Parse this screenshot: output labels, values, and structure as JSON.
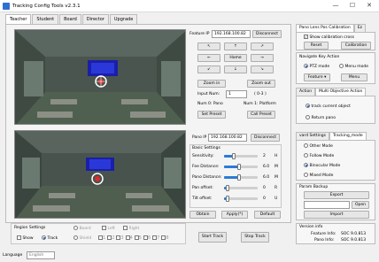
{
  "window": {
    "title": "Tracking Config Tools v2.3.1",
    "min": "—",
    "max": "☐",
    "close": "✕"
  },
  "tabs": [
    "Teacher",
    "Student",
    "Board",
    "Director",
    "Upgrade"
  ],
  "top": {
    "feature_ip_label": "Feature IP",
    "feature_ip": "192.168.100.82",
    "disconnect": "Disconnect",
    "dir_up_left": "↖",
    "dir_up": "↑",
    "dir_up_right": "↗",
    "dir_left": "←",
    "home": "Home",
    "dir_right": "→",
    "dir_down_left": "↙",
    "dir_down": "↓",
    "dir_down_right": "↘",
    "zoom_in": "Zoom in",
    "zoom_out": "Zoom out",
    "input_num_label": "Input Num:",
    "input_num": "1",
    "range": "( 0-3 )",
    "num0": "Num 0: Pano",
    "num1": "Num 1: Platform",
    "set_preset": "Set Preset",
    "call_preset": "Call Preset"
  },
  "bottom": {
    "pano_ip_label": "Pano IP",
    "pano_ip": "192.168.100.82",
    "disconnect": "Disconnect",
    "basic_settings": "Basic Settings",
    "rows": [
      {
        "label": "Sensitivity:",
        "value": "2",
        "unit": "H",
        "fill": 0.3
      },
      {
        "label": "Fee Distance:",
        "value": "6.0",
        "unit": "M",
        "fill": 0.45
      },
      {
        "label": "Pano Distance:",
        "value": "6.0",
        "unit": "M",
        "fill": 0.45
      },
      {
        "label": "Pan offset:",
        "value": "0",
        "unit": "R",
        "fill": 0.1
      },
      {
        "label": "Tilt offset:",
        "value": "0",
        "unit": "U",
        "fill": 0.1
      }
    ],
    "obtain": "Obtain",
    "apply": "Apply(*)",
    "default": "Default"
  },
  "region": {
    "title": "Region Settings",
    "board": "Board",
    "left": "Left",
    "right": "Right",
    "show": "Show",
    "track": "Track",
    "shield": "Shield",
    "nums": [
      "1",
      "2",
      "3",
      "4",
      "5",
      "6",
      "7",
      "8"
    ]
  },
  "start_track": "Start Track",
  "stop_track": "Stop Track",
  "language_label": "Language",
  "language_value": "English",
  "right": {
    "cal_tab1": "Pano Lens Pos Calibration",
    "cal_tab2": "Ez",
    "show_cross": "Show calibration cross",
    "reset": "Reset",
    "calibration": "Calibration",
    "nav_title": "Navigate Key Action",
    "ptz_mode": "PTZ mode",
    "menu_mode": "Menu mode",
    "feature": "Feature ▾",
    "menu": "Menu",
    "mo_tab1": "Action",
    "mo_tab2": "Multi Objective Action",
    "track_current": "track current object",
    "return_pano": "Return pano",
    "tm_tab1": "vard Settings",
    "tm_tab2": "Tracking_mode",
    "other_mode": "Other Mode",
    "follow_mode": "Follow Mode",
    "binocular_mode": "Binocular Mode",
    "mixed_mode": "Mixed Mode",
    "param_title": "Param Backup",
    "export": "Export",
    "open": "Open",
    "import": "Import",
    "ver_title": "Version info",
    "feature_info_label": "Feature Info:",
    "feature_info": "SOC 9.0.813",
    "pano_info_label": "Pano Info:",
    "pano_info": "SOC 9.0.813"
  }
}
